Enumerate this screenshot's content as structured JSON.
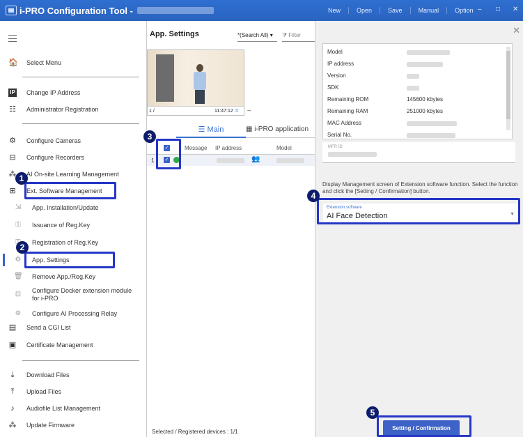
{
  "window": {
    "title": "i-PRO Configuration Tool -",
    "menu": [
      "New",
      "Open",
      "Save",
      "Manual",
      "Option"
    ],
    "minimize": "–",
    "maximize": "□",
    "close": "✕"
  },
  "sidebar": {
    "items": [
      {
        "label": "Select Menu",
        "icon": "home-icon",
        "glyph": "🏠"
      },
      {
        "label": "Change IP Address",
        "icon": "ip-icon",
        "glyph": "IP"
      },
      {
        "label": "Administrator Registration",
        "icon": "admin-icon",
        "glyph": "☷"
      },
      {
        "label": "Configure Cameras",
        "icon": "camera-settings-icon",
        "glyph": "⚙"
      },
      {
        "label": "Configure Recorders",
        "icon": "recorder-icon",
        "glyph": "⊟"
      },
      {
        "label": "AI On-site Learning Management",
        "icon": "ai-learning-icon",
        "glyph": "⁂"
      },
      {
        "label": "Ext. Software Management",
        "icon": "ext-software-icon",
        "glyph": "⊞"
      },
      {
        "label": "App. Installation/Update",
        "icon": "app-install-icon",
        "glyph": "⇲"
      },
      {
        "label": "Issuance of Reg.Key",
        "icon": "key-issue-icon",
        "glyph": "⚿"
      },
      {
        "label": "Registration of Reg.Key",
        "icon": "key-register-icon",
        "glyph": "⚿"
      },
      {
        "label": "App. Settings",
        "icon": "app-settings-icon",
        "glyph": "⚙"
      },
      {
        "label": "Remove App./Reg.Key",
        "icon": "remove-app-icon",
        "glyph": "🗑"
      },
      {
        "label": "Configure Docker extension module",
        "label2": "for i-PRO",
        "icon": "docker-icon",
        "glyph": "⊡"
      },
      {
        "label": "Configure AI Processing Relay",
        "icon": "relay-icon",
        "glyph": "⊚"
      },
      {
        "label": "Send a CGI List",
        "icon": "cgi-icon",
        "glyph": "▤"
      },
      {
        "label": "Certificate Management",
        "icon": "certificate-icon",
        "glyph": "▣"
      },
      {
        "label": "Download Files",
        "icon": "download-icon",
        "glyph": "⤓"
      },
      {
        "label": "Upload Files",
        "icon": "upload-icon",
        "glyph": "⤒"
      },
      {
        "label": "Audiofile List Management",
        "icon": "audio-icon",
        "glyph": "♪"
      },
      {
        "label": "Update Firmware",
        "icon": "firmware-icon",
        "glyph": "⁂"
      }
    ]
  },
  "center": {
    "title": "App. Settings",
    "search_value": "*(Search All)",
    "filter_placeholder": "Filter",
    "camera": {
      "channel": "1 /",
      "time": "11:47:12",
      "dash": "--"
    },
    "tabs": [
      {
        "label": "Main",
        "icon": "list-icon"
      },
      {
        "label": "i-PRO application",
        "icon": "app-grid-icon"
      }
    ],
    "table": {
      "headers": [
        "Message",
        "IP address",
        "Model"
      ],
      "row_index": "1"
    },
    "status": "Selected / Registered devices : 1/1"
  },
  "right": {
    "info_labels": [
      "Model",
      "IP address",
      "Version",
      "SDK",
      "Remaining ROM",
      "Remaining RAM",
      "MAC Address",
      "Serial No."
    ],
    "rom_value": "145600 kbytes",
    "ram_value": "251000 kbytes",
    "mfr_label": "MFR ID",
    "description": "Display Management screen of Extension software function. Select the function and click the [Setting / Confirmation] button.",
    "ext_label": "Extension software",
    "ext_value": "AI Face Detection",
    "button": "Setting / Confirmation"
  },
  "annotations": [
    "1",
    "2",
    "3",
    "4",
    "5"
  ],
  "colors": {
    "titlebar": "#2f6fd0",
    "highlight": "#2536c7",
    "badge": "#0d1d6b",
    "accent": "#3a63c9"
  }
}
